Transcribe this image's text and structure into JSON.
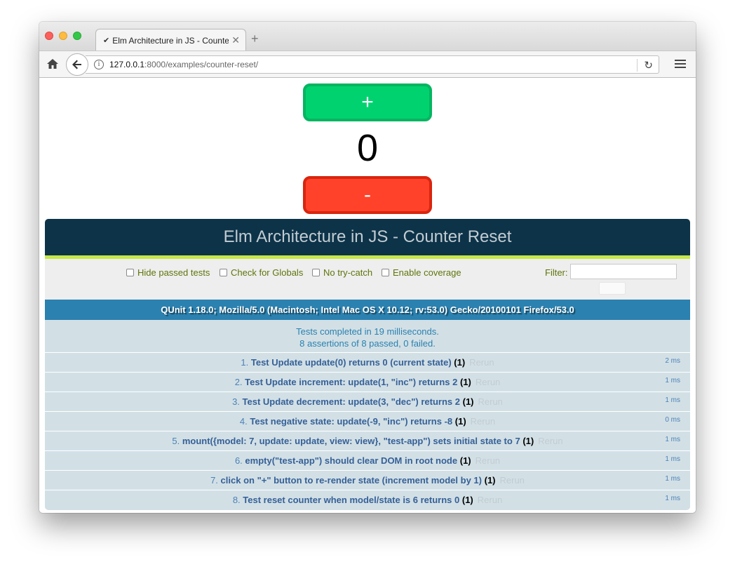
{
  "browser": {
    "tab_title": "Elm Architecture in JS - Counter Reset",
    "tab_check": "✔",
    "url_host": "127.0.0.1",
    "url_path": ":8000/examples/counter-reset/"
  },
  "app": {
    "increment_label": "+",
    "count": "0",
    "decrement_label": "-"
  },
  "qunit": {
    "title": "Elm Architecture in JS - Counter Reset",
    "options": {
      "hide_passed": "Hide passed tests",
      "check_globals": "Check for Globals",
      "no_try_catch": "No try-catch",
      "enable_coverage": "Enable coverage",
      "filter_label": "Filter:"
    },
    "user_agent": "QUnit 1.18.0; Mozilla/5.0 (Macintosh; Intel Mac OS X 10.12; rv:53.0) Gecko/20100101 Firefox/53.0",
    "summary_line1": "Tests completed in 19 milliseconds.",
    "summary_line2": "8 assertions of 8 passed, 0 failed.",
    "rerun_label": "Rerun",
    "tests": [
      {
        "num": "1.",
        "name": "Test Update update(0) returns 0 (current state)",
        "count": "(1)",
        "time": "2 ms"
      },
      {
        "num": "2.",
        "name": "Test Update increment: update(1, \"inc\") returns 2",
        "count": "(1)",
        "time": "1 ms"
      },
      {
        "num": "3.",
        "name": "Test Update decrement: update(3, \"dec\") returns 2",
        "count": "(1)",
        "time": "1 ms"
      },
      {
        "num": "4.",
        "name": "Test negative state: update(-9, \"inc\") returns -8",
        "count": "(1)",
        "time": "0 ms"
      },
      {
        "num": "5.",
        "name": "mount({model: 7, update: update, view: view}, \"test-app\") sets initial state to 7",
        "count": "(1)",
        "time": "1 ms"
      },
      {
        "num": "6.",
        "name": "empty(\"test-app\") should clear DOM in root node",
        "count": "(1)",
        "time": "1 ms"
      },
      {
        "num": "7.",
        "name": "click on \"+\" button to re-render state (increment model by 1)",
        "count": "(1)",
        "time": "1 ms"
      },
      {
        "num": "8.",
        "name": "Test reset counter when model/state is 6 returns 0",
        "count": "(1)",
        "time": "1 ms"
      }
    ]
  }
}
